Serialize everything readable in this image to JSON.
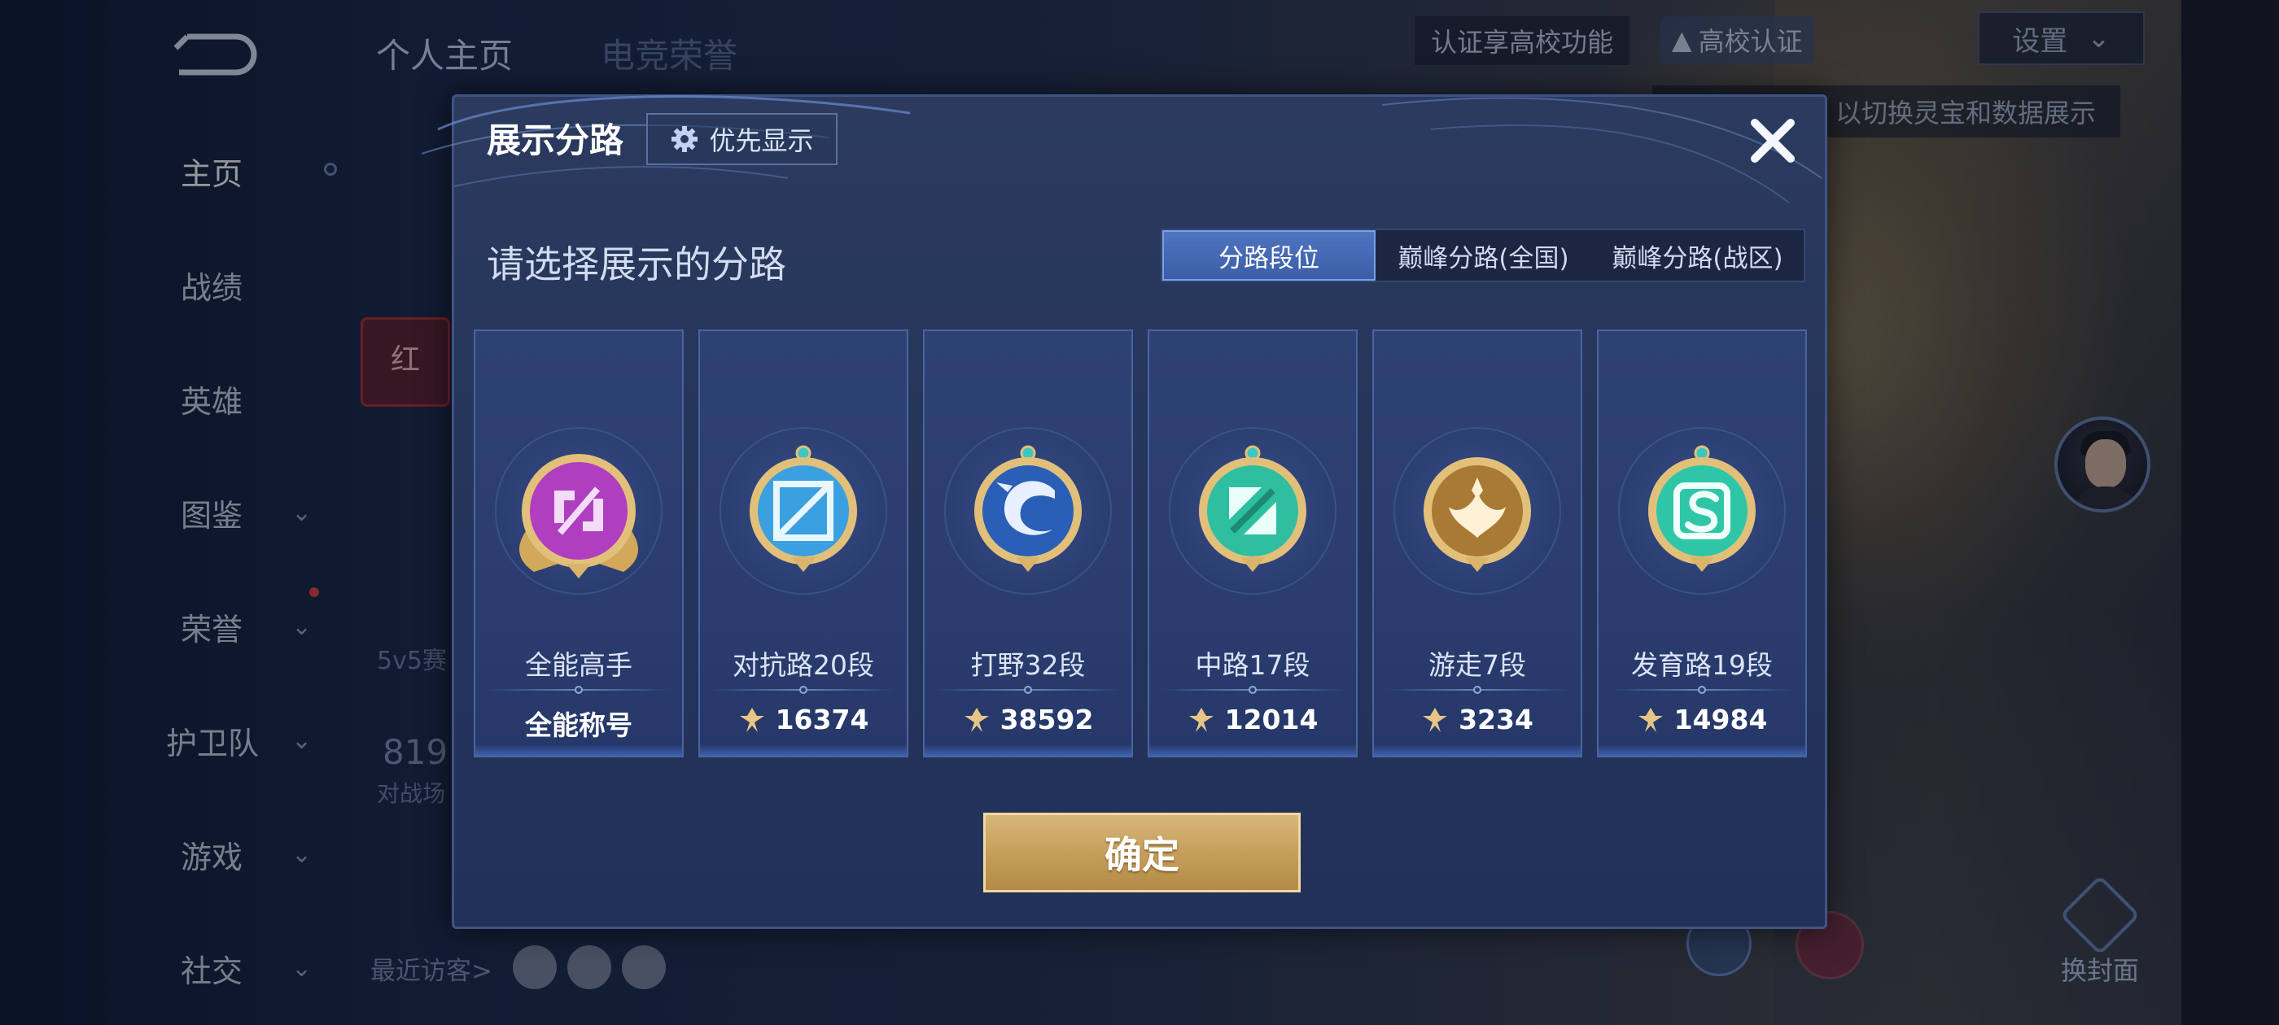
{
  "background": {
    "top_tabs": [
      "个人主页",
      "电竞荣誉"
    ],
    "nav_items": [
      {
        "label": "主页",
        "has_chevron": false
      },
      {
        "label": "战绩",
        "has_chevron": false
      },
      {
        "label": "英雄",
        "has_chevron": false
      },
      {
        "label": "图鉴",
        "has_chevron": true
      },
      {
        "label": "荣誉",
        "has_chevron": true
      },
      {
        "label": "护卫队",
        "has_chevron": true
      },
      {
        "label": "游戏",
        "has_chevron": true
      },
      {
        "label": "社交",
        "has_chevron": true
      }
    ],
    "cert_text": "认证享高校功能",
    "cert_button": "高校认证",
    "settings": "设置",
    "tooltip": "以切换灵宝和数据展示",
    "swap_cover": "换封面",
    "recent_visitors": "最近访客>",
    "text_5v5": "5v5赛",
    "num_819": "819",
    "sub_819": "对战场",
    "tile_text": "红"
  },
  "dialog": {
    "title": "展示分路",
    "priority_button": "优先显示",
    "subtitle": "请选择展示的分路",
    "tabs": [
      {
        "label": "分路段位",
        "active": true
      },
      {
        "label": "巅峰分路(全国)",
        "active": false
      },
      {
        "label": "巅峰分路(战区)",
        "active": false
      }
    ],
    "cards": [
      {
        "label": "全能高手",
        "value": "全能称号",
        "icon": "all-round-badge-icon",
        "color": "#b03fc0",
        "has_score_icon": false
      },
      {
        "label": "对抗路20段",
        "value": "16374",
        "icon": "clash-lane-badge-icon",
        "color": "#3aa0e0",
        "has_score_icon": true
      },
      {
        "label": "打野32段",
        "value": "38592",
        "icon": "jungle-badge-icon",
        "color": "#2a5fb8",
        "has_score_icon": true
      },
      {
        "label": "中路17段",
        "value": "12014",
        "icon": "mid-lane-badge-icon",
        "color": "#2fbfa0",
        "has_score_icon": true
      },
      {
        "label": "游走7段",
        "value": "3234",
        "icon": "roam-badge-icon",
        "color": "#a87a34",
        "has_score_icon": true
      },
      {
        "label": "发育路19段",
        "value": "14984",
        "icon": "farm-lane-badge-icon",
        "color": "#2fc6a8",
        "has_score_icon": true
      }
    ],
    "confirm_button": "确定"
  }
}
